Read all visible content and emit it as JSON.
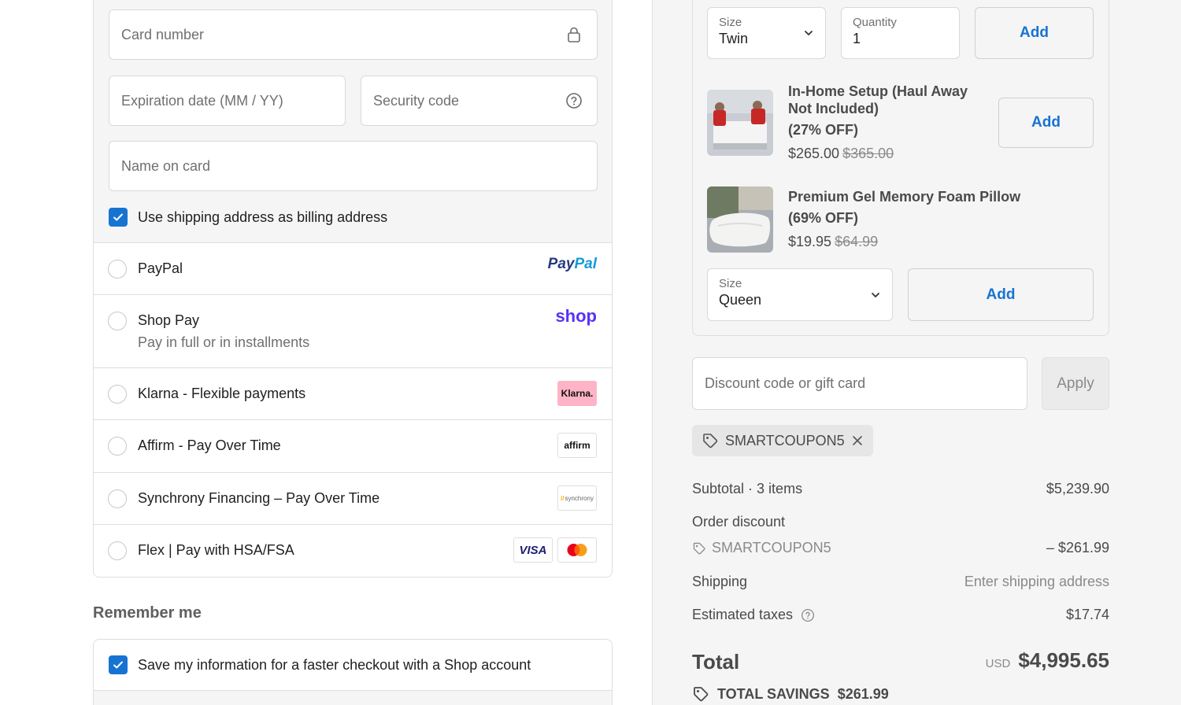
{
  "card_form": {
    "card_number_placeholder": "Card number",
    "expiration_placeholder": "Expiration date (MM / YY)",
    "security_placeholder": "Security code",
    "name_placeholder": "Name on card",
    "billing_checkbox_label": "Use shipping address as billing address",
    "billing_checked": true
  },
  "payment_methods": [
    {
      "label": "PayPal",
      "sub": "",
      "logo": "PayPal"
    },
    {
      "label": "Shop Pay",
      "sub": "Pay in full or in installments",
      "logo": "shop"
    },
    {
      "label": "Klarna - Flexible payments",
      "sub": "",
      "logo": "Klarna."
    },
    {
      "label": "Affirm - Pay Over Time",
      "sub": "",
      "logo": "affirm"
    },
    {
      "label": "Synchrony Financing – Pay Over Time",
      "sub": "",
      "logo": "synchrony"
    },
    {
      "label": "Flex | Pay with HSA/FSA",
      "sub": "",
      "logo": "VISA"
    }
  ],
  "remember": {
    "title": "Remember me",
    "save_label": "Save my information for a faster checkout with a Shop account",
    "save_checked": true
  },
  "upsell": {
    "top_size_caption": "Size",
    "top_size_value": "Twin",
    "top_qty_caption": "Quantity",
    "top_qty_value": "1",
    "add_label": "Add",
    "products": [
      {
        "name": "In-Home Setup (Haul Away Not Included)",
        "discount": "(27% OFF)",
        "price": "$265.00",
        "old_price": "$365.00"
      },
      {
        "name": "Premium Gel Memory Foam Pillow",
        "discount": "(69% OFF)",
        "price": "$19.95",
        "old_price": "$64.99"
      }
    ],
    "pillow_size_caption": "Size",
    "pillow_size_value": "Queen"
  },
  "discount": {
    "placeholder": "Discount code or gift card",
    "apply_label": "Apply",
    "applied_code": "SMARTCOUPON5"
  },
  "summary": {
    "subtotal_label": "Subtotal · 3 items",
    "subtotal_value": "$5,239.90",
    "order_discount_label": "Order discount",
    "discount_code": "SMARTCOUPON5",
    "discount_value": "– $261.99",
    "shipping_label": "Shipping",
    "shipping_value": "Enter shipping address",
    "taxes_label": "Estimated taxes",
    "taxes_value": "$17.74",
    "total_label": "Total",
    "currency": "USD",
    "total_value": "$4,995.65",
    "savings_label": "TOTAL SAVINGS",
    "savings_value": "$261.99"
  },
  "colors": {
    "accent": "#1773d2",
    "paypal_dark": "#253b80",
    "paypal_light": "#179bd7",
    "shop": "#5a31f4",
    "klarna_bg": "#ffb3c7"
  }
}
